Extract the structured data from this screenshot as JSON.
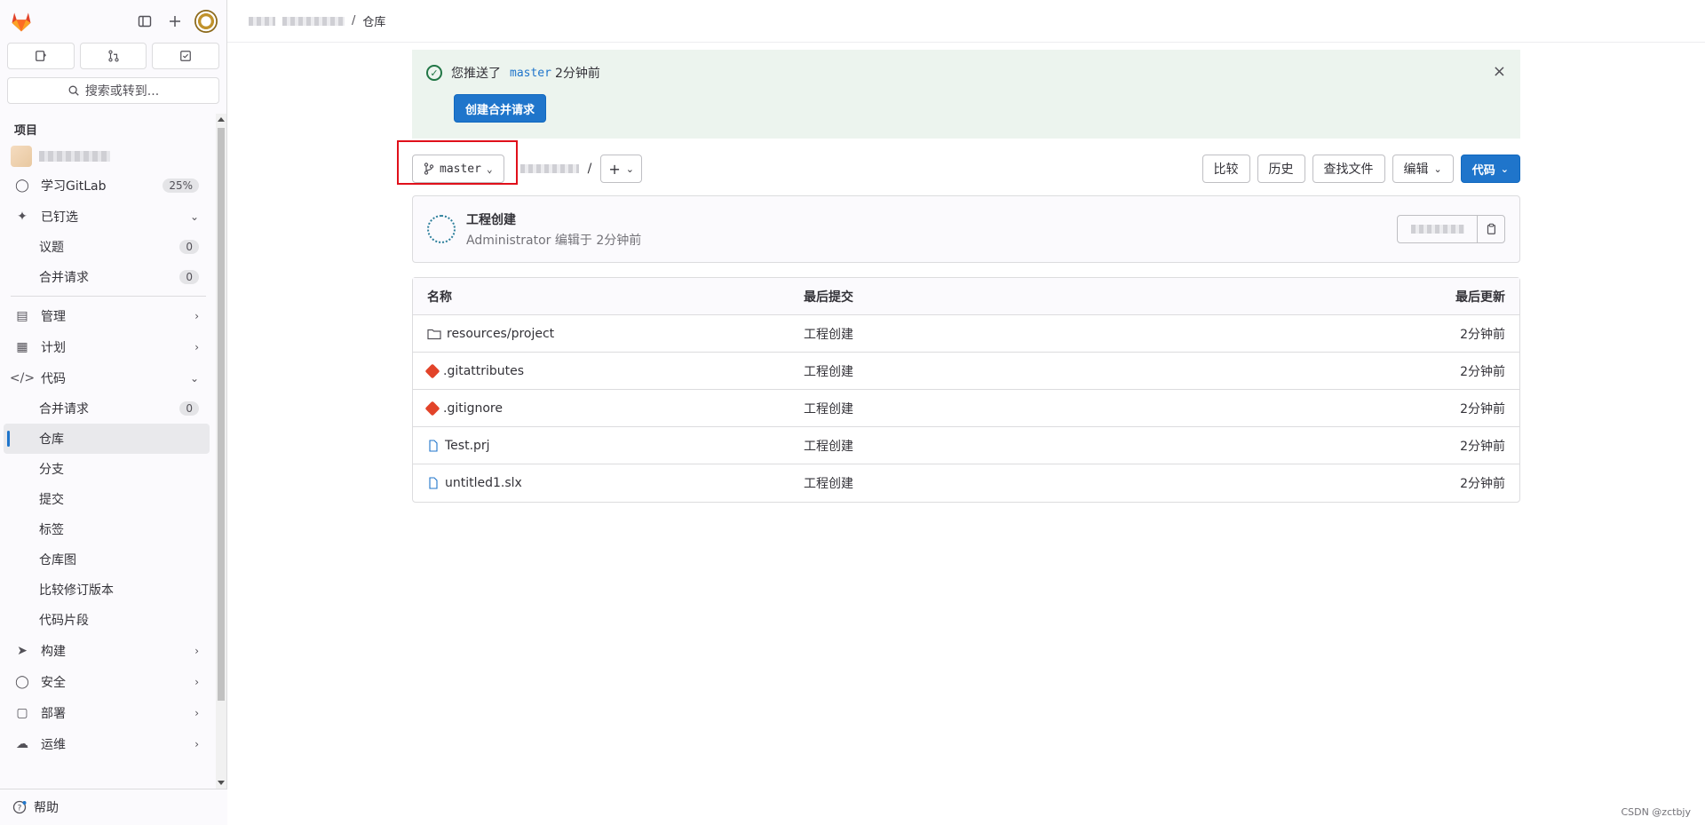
{
  "sidebar": {
    "search_label": "搜索或转到...",
    "section_title": "项目",
    "items": [
      {
        "label": "学习GitLab",
        "badge": "25%"
      },
      {
        "label": "已钉选"
      },
      {
        "label": "议题",
        "badge": "0"
      },
      {
        "label": "合并请求",
        "badge": "0"
      },
      {
        "label": "管理"
      },
      {
        "label": "计划"
      },
      {
        "label": "代码"
      },
      {
        "label": "合并请求",
        "badge": "0"
      },
      {
        "label": "仓库"
      },
      {
        "label": "分支"
      },
      {
        "label": "提交"
      },
      {
        "label": "标签"
      },
      {
        "label": "仓库图"
      },
      {
        "label": "比较修订版本"
      },
      {
        "label": "代码片段"
      },
      {
        "label": "构建"
      },
      {
        "label": "安全"
      },
      {
        "label": "部署"
      },
      {
        "label": "运维"
      }
    ],
    "help_label": "帮助"
  },
  "breadcrumb": {
    "separator": "/",
    "current": "仓库"
  },
  "alert": {
    "text_before": "您推送了",
    "branch": "master",
    "text_after": "2分钟前",
    "button_label": "创建合并请求",
    "close_icon": "×"
  },
  "toolbar": {
    "branch": "master",
    "path_separator": "/",
    "add_label": "+",
    "compare_label": "比较",
    "history_label": "历史",
    "find_file_label": "查找文件",
    "edit_label": "编辑",
    "code_label": "代码"
  },
  "commit": {
    "title": "工程创建",
    "meta": "Administrator 编辑于 2分钟前"
  },
  "table": {
    "headers": [
      "名称",
      "最后提交",
      "最后更新"
    ],
    "rows": [
      {
        "name": "resources/project",
        "icon": "folder-icon",
        "commit": "工程创建",
        "updated": "2分钟前"
      },
      {
        "name": ".gitattributes",
        "icon": "git-icon",
        "commit": "工程创建",
        "updated": "2分钟前"
      },
      {
        "name": ".gitignore",
        "icon": "git-icon",
        "commit": "工程创建",
        "updated": "2分钟前"
      },
      {
        "name": "Test.prj",
        "icon": "file-icon",
        "commit": "工程创建",
        "updated": "2分钟前"
      },
      {
        "name": "untitled1.slx",
        "icon": "file-icon",
        "commit": "工程创建",
        "updated": "2分钟前"
      }
    ]
  },
  "footer": {
    "watermark": "CSDN @zctbjy"
  },
  "colors": {
    "accent": "#1f75cb",
    "alert_bg": "#ecf4ee",
    "highlight_box": "#e0101a"
  }
}
